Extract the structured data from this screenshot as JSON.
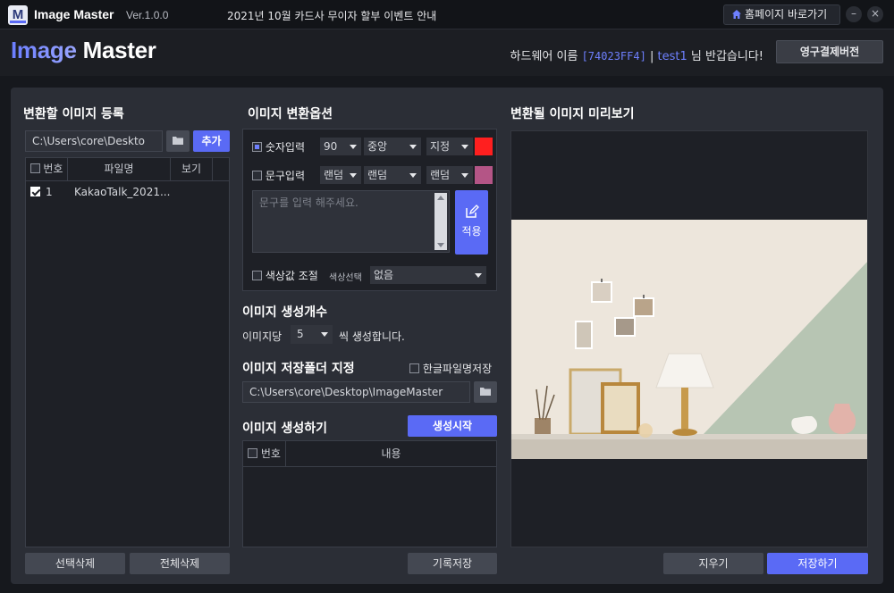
{
  "titlebar": {
    "app_name": "Image Master",
    "version": "Ver.1.0.0",
    "notice": "2021년 10월 카드사 무이자 할부 이벤트 안내",
    "home_button": "홈페이지 바로가기",
    "minimize": "–",
    "close": "×"
  },
  "header": {
    "logo_part1": "Image",
    "logo_part2": "Master",
    "hardware_label": "하드웨어 이름",
    "hardware_id": "[74023FF4]",
    "separator": "|",
    "username": "test1",
    "greeting": "님 반갑습니다!",
    "permanent_button": "영구결제버전"
  },
  "register": {
    "title": "변환할 이미지 등록",
    "path_value": "C:\\Users\\core\\Deskto",
    "add_button": "추가",
    "columns": [
      "번호",
      "파일명",
      "보기"
    ],
    "rows": [
      {
        "checked": true,
        "num": "1",
        "filename": "KakaoTalk_2021..."
      }
    ],
    "delete_selected": "선택삭제",
    "delete_all": "전체삭제"
  },
  "options": {
    "title": "이미지 변환옵션",
    "number_input": {
      "label": "숫자입력",
      "checked": true,
      "size": "90",
      "position": "중앙",
      "mode": "지정",
      "color": "#ff1f1f"
    },
    "text_input": {
      "label": "문구입력",
      "checked": false,
      "size": "랜덤",
      "position": "랜덤",
      "mode": "랜덤",
      "color": "#b45586"
    },
    "textarea_placeholder": "문구를 입력 해주세요.",
    "apply_button": "적용",
    "color_adjust": {
      "label": "색상값 조절",
      "checked": false,
      "select_label": "색상선택",
      "value": "없음"
    }
  },
  "count": {
    "title": "이미지 생성개수",
    "prefix": "이미지당",
    "value": "5",
    "suffix": "씩 생성합니다."
  },
  "folder": {
    "title": "이미지 저장폴더 지정",
    "korean_filename_label": "한글파일명저장",
    "path_value": "C:\\Users\\core\\Desktop\\ImageMaster"
  },
  "generate": {
    "title": "이미지 생성하기",
    "start_button": "생성시작",
    "columns": [
      "번호",
      "내용"
    ],
    "save_log_button": "기록저장"
  },
  "preview": {
    "title": "변환될 이미지 미리보기",
    "erase_button": "지우기",
    "save_button": "저장하기"
  }
}
